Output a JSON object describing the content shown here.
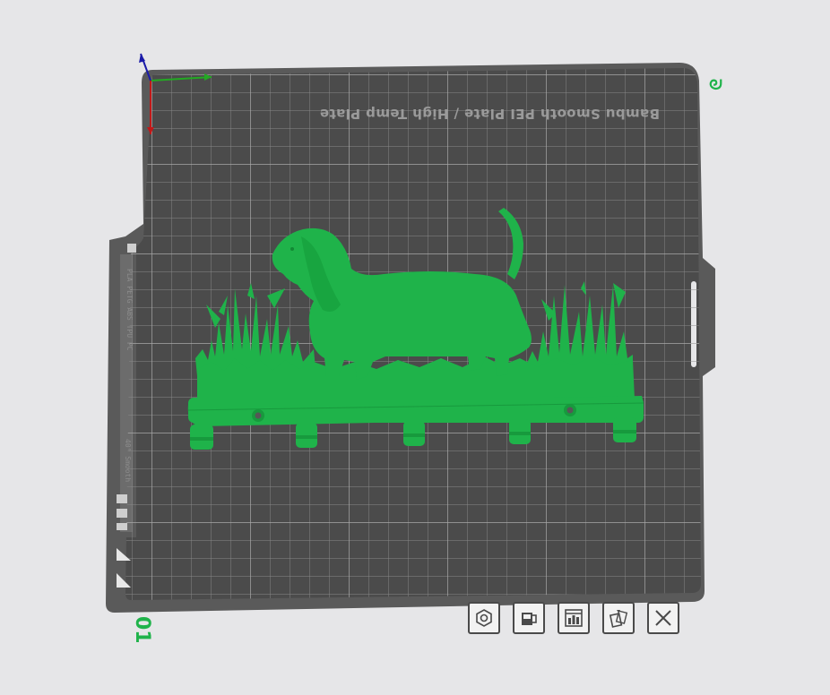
{
  "plate": {
    "label": "Bambu Smooth PEI Plate / High Temp Plate",
    "number": "01",
    "name_mark": "ᘐ",
    "side_filaments": "PLA PETG ABS TPU PC",
    "side_note": "40° Smooth"
  },
  "model": {
    "description_color": "#1fb34a"
  },
  "toolbar": {
    "buttons": [
      {
        "name": "arrange-icon"
      },
      {
        "name": "lock-icon"
      },
      {
        "name": "plate-settings-icon"
      },
      {
        "name": "pick-objects-icon"
      },
      {
        "name": "close-icon"
      }
    ]
  },
  "colors": {
    "background": "#e6e6e8",
    "plate": "#4b4b4b",
    "grid": "#8a8a8a",
    "model": "#1fb34a",
    "axis_x": "#23a923",
    "axis_y": "#c01818",
    "axis_z": "#1a1aa8"
  }
}
